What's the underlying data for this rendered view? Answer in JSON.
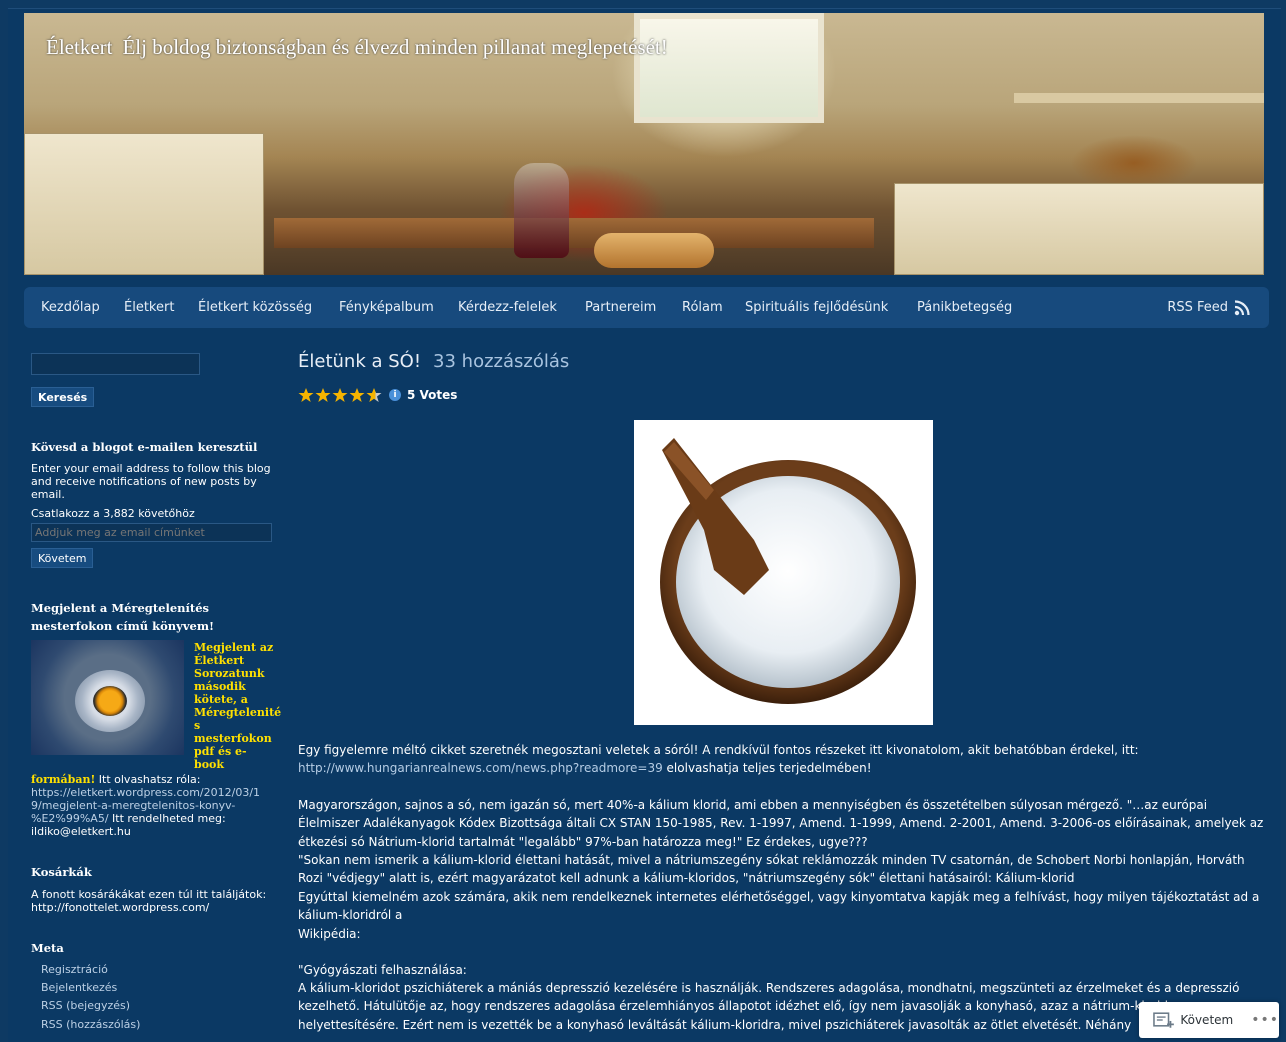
{
  "site": {
    "title": "Életkert",
    "description": "Élj boldog biztonságban és élvezd minden pillanat meglepetését!"
  },
  "nav": {
    "items": [
      "Kezdőlap",
      "Életkert",
      "Életkert közösség",
      "Fényképalbum",
      "Kérdezz-felelek",
      "Partnereim",
      "Rólam",
      "Spirituális fejlődésünk",
      "Pánikbetegség"
    ],
    "rss_label": "RSS Feed"
  },
  "sidebar": {
    "search_button": "Keresés",
    "follow_widget": {
      "title": "Kövesd a blogot e-mailen keresztül",
      "text": "Enter your email address to follow this blog and receive notifications of new posts by email.",
      "count_text": "Csatlakozz a 3,882 követőhöz",
      "placeholder": "Addjuk meg az email címünket",
      "button": "Követem"
    },
    "book_widget": {
      "title": "Megjelent a Méregtelenítés mesterfokon című könyvem!",
      "highlight_lines": [
        "Megjelent az",
        "Életkert",
        "Sorozatunk",
        "második",
        "kötete, a",
        "Méregtelenité",
        "s",
        "mesterfokon",
        "pdf és e-",
        "book"
      ],
      "highlight_tail": "formában!",
      "text_after": " Itt olvashatsz róla:",
      "link_lines": [
        "https://eletkert.wordpress.com/2012/03/1",
        "9/megjelent-a-meregtelenitos-konyv-",
        "%E2%99%A5/"
      ],
      "text_order": " Itt rendelheted meg:",
      "email": "ildiko@eletkert.hu"
    },
    "baskets_widget": {
      "title": "Kosárkák",
      "text": "A fonott kosárákákat ezen túl itt találjátok:",
      "link": "http://fonottelet.wordpress.com/"
    },
    "meta_widget": {
      "title": "Meta",
      "links": [
        "Regisztráció",
        "Bejelentkezés",
        "RSS (bejegyzés)",
        "RSS (hozzászólás)"
      ]
    }
  },
  "post": {
    "title": "Életünk a SÓ!",
    "comments": "33 hozzászólás",
    "rating_stars": 4.5,
    "votes": "5 Votes",
    "p1": "Egy figyelemre méltó cikket szeretnék megosztani veletek a sóról! A rendkívül fontos részeket itt kivonatolom, akit behatóbban érdekel, itt:",
    "p1_link": "http://www.hungarianrealnews.com/news.php?readmore=39",
    "p1_tail": " elolvashatja teljes terjedelmében!",
    "p2": "Magyarországon, sajnos a só, nem igazán só, mert 40%-a kálium klorid, ami ebben a mennyiségben és összetételben súlyosan mérgező. \"…az európai Élelmiszer Adalékanyagok Kódex Bizottsága általi CX STAN 150-1985, Rev. 1-1997, Amend. 1-1999, Amend. 2-2001, Amend. 3-2006-os előírásainak, amelyek az étkezési só Nátrium-klorid tartalmát \"legalább\" 97%-ban határozza meg!\" Ez érdekes, ugye???",
    "p3": "\"Sokan nem ismerik a kálium-klorid élettani hatását, mivel a nátriumszegény sókat reklámozzák minden TV csatornán, de Schobert Norbi honlapján, Horváth Rozi \"védjegy\" alatt is, ezért magyarázatot kell adnunk a kálium-kloridos, \"nátriumszegény sók\" élettani hatásairól: Kálium-klorid",
    "p4": "Egyúttal kiemelném azok számára, akik nem rendelkeznek internetes elérhetőséggel, vagy kinyomtatva kapják meg a felhívást, hogy milyen tájékoztatást ad a kálium-kloridról a",
    "p5": "Wikipédia:",
    "p6": "\"Gyógyászati felhasználása:",
    "p7": "A kálium-kloridot pszichiáterek a mániás depresszió kezelésére is használják. Rendszeres adagolása, mondhatni, megszünteti az érzelmeket és a depresszió kezelhető. Hátulütője az, hogy rendszeres adagolása érzelemhiányos állapotot idézhet elő, így nem javasolják a konyhasó, azaz a nátrium-klorid helyettesítésére. Ezért nem is vezették be a konyhasó leváltását kálium-kloridra, mivel pszichiáterek javasolták az ötlet elvetését. Néhány"
  },
  "follow_bar": {
    "label": "Követem",
    "more": "•••"
  },
  "colors": {
    "background": "#0b3964",
    "nav": "#174a7d",
    "highlight": "#ffe000",
    "link": "#b6cde5",
    "star": "#f5b400"
  }
}
